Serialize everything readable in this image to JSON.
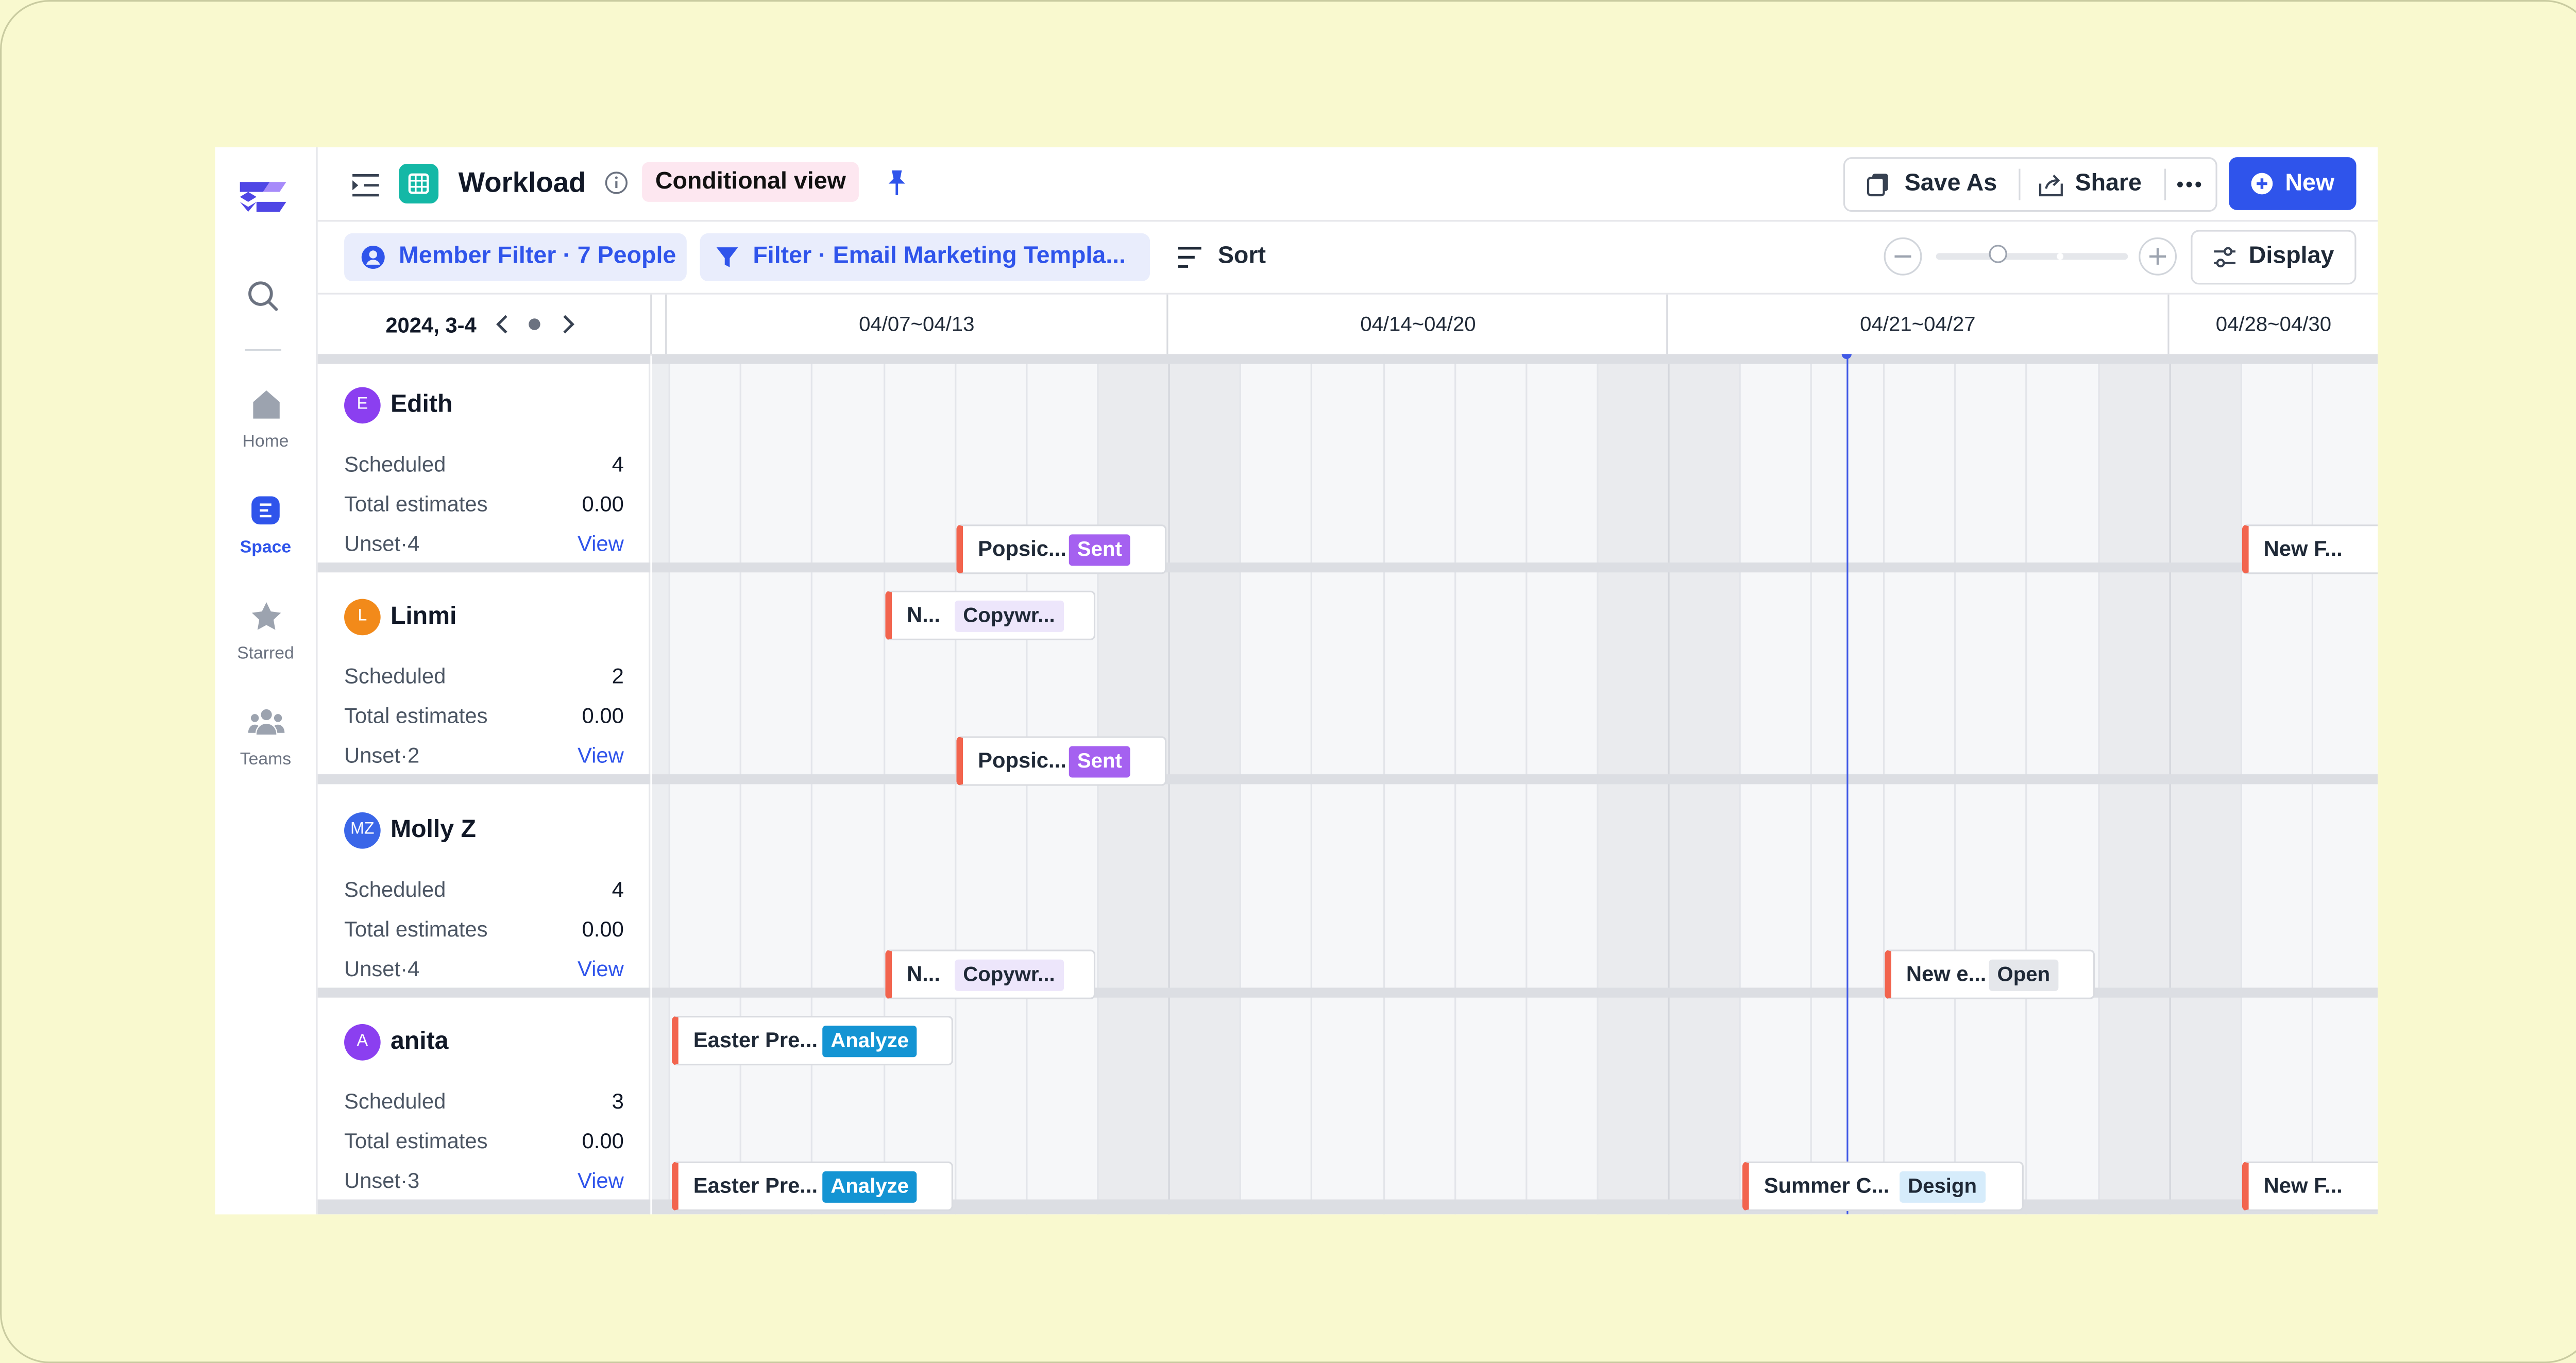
{
  "colors": {
    "background": "#f9f9cf",
    "accent": "#2f54eb",
    "bar_edge": "#f2644e",
    "today_line": "#4059e6",
    "status_sent": "#a561f0",
    "status_analyze": "#1494d3",
    "status_design_bg": "#d6ecfb",
    "status_copy_bg": "#ede6fb",
    "status_open_bg": "#e5e7eb"
  },
  "sidebar": {
    "logo_icon": "app-logo",
    "search_icon": "search-icon",
    "items": [
      {
        "label": "Home",
        "icon": "home-icon",
        "active": false
      },
      {
        "label": "Space",
        "icon": "space-icon",
        "active": true
      },
      {
        "label": "Starred",
        "icon": "star-icon",
        "active": false
      },
      {
        "label": "Teams",
        "icon": "teams-icon",
        "active": false
      }
    ]
  },
  "header": {
    "title": "Workload",
    "view_chip": "Conditional view",
    "save_as": "Save As",
    "share": "Share",
    "new": "New"
  },
  "filters": {
    "member_filter": "Member Filter · 7 People",
    "filter": "Filter · Email Marketing Templa...",
    "sort": "Sort",
    "display": "Display"
  },
  "calendar": {
    "range_label": "2024, 3-4",
    "weeks": [
      "04/07~04/13",
      "04/14~04/20",
      "04/21~04/27",
      "04/28~04/30"
    ]
  },
  "members": [
    {
      "initials": "E",
      "name": "Edith",
      "color": "#8b3ff0",
      "scheduled_label": "Scheduled",
      "scheduled": "4",
      "estimates_label": "Total estimates",
      "estimates": "0.00",
      "unset": "Unset·4",
      "view": "View"
    },
    {
      "initials": "L",
      "name": "Linmi",
      "color": "#f28a1a",
      "scheduled_label": "Scheduled",
      "scheduled": "2",
      "estimates_label": "Total estimates",
      "estimates": "0.00",
      "unset": "Unset·2",
      "view": "View"
    },
    {
      "initials": "MZ",
      "name": "Molly Z",
      "color": "#3a66e8",
      "scheduled_label": "Scheduled",
      "scheduled": "4",
      "estimates_label": "Total estimates",
      "estimates": "0.00",
      "unset": "Unset·4",
      "view": "View"
    },
    {
      "initials": "A",
      "name": "anita",
      "color": "#8b3ff0",
      "scheduled_label": "Scheduled",
      "scheduled": "3",
      "estimates_label": "Total estimates",
      "estimates": "0.00",
      "unset": "Unset·3",
      "view": "View"
    }
  ],
  "tasks": [
    {
      "name": "Popsic...",
      "status": "Sent"
    },
    {
      "name": "N...",
      "status": "Copywr..."
    },
    {
      "name": "New F...",
      "status": ""
    },
    {
      "name": "Popsic...",
      "status": "Sent"
    },
    {
      "name": "N...",
      "status": "Copywr..."
    },
    {
      "name": "New e...",
      "status": "Open"
    },
    {
      "name": "Easter Pre...",
      "status": "Analyze"
    },
    {
      "name": "Easter Pre...",
      "status": "Analyze"
    },
    {
      "name": "Summer C...",
      "status": "Design"
    },
    {
      "name": "New F...",
      "status": ""
    }
  ]
}
